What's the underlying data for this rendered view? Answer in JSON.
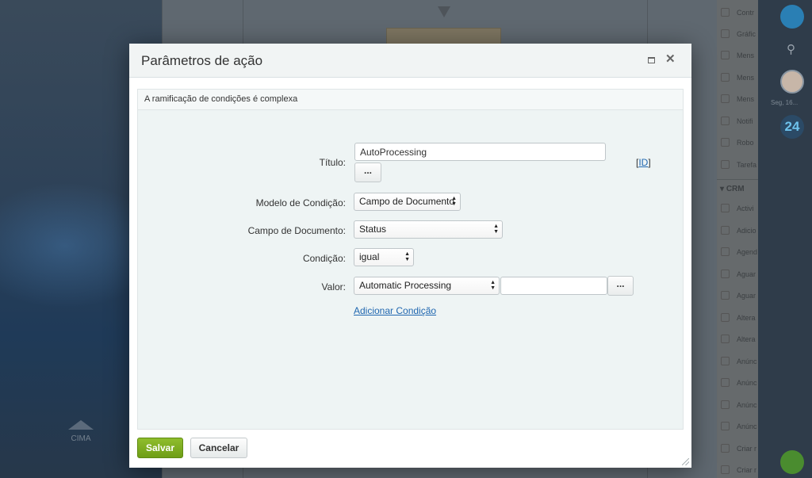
{
  "background": {
    "scroll_up_label": "CIMA",
    "right_panel": {
      "items": [
        "Contr",
        "Gráfic",
        "Mens",
        "Mens",
        "Mens",
        "Notifi",
        "Robo",
        "Tarefa"
      ],
      "section_label": "CRM",
      "crm_items": [
        "Activi",
        "Adicio",
        "Agend",
        "Aguar",
        "Aguar",
        "Altera",
        "Altera",
        "Anúnc",
        "Anúnc",
        "Anúnc",
        "Anúnc",
        "Criar r",
        "Criar r"
      ]
    },
    "far_right": {
      "date": "Seg, 16...",
      "b24_label": "24"
    }
  },
  "dialog": {
    "title": "Parâmetros de ação",
    "caption": "A ramificação de condições é complexa",
    "fields": {
      "titulo": {
        "label": "Título:",
        "value": "AutoProcessing",
        "dots": "...",
        "id_open": "[",
        "id_link": "ID",
        "id_close": "]"
      },
      "modelo": {
        "label": "Modelo de Condição:",
        "value": "Campo de Documento"
      },
      "campo": {
        "label": "Campo de Documento:",
        "value": "Status"
      },
      "condicao": {
        "label": "Condição:",
        "value": "igual"
      },
      "valor": {
        "label": "Valor:",
        "value": "Automatic Processing",
        "text_value": "",
        "dots": "..."
      }
    },
    "add_condition": "Adicionar Condição",
    "buttons": {
      "save": "Salvar",
      "cancel": "Cancelar"
    }
  }
}
